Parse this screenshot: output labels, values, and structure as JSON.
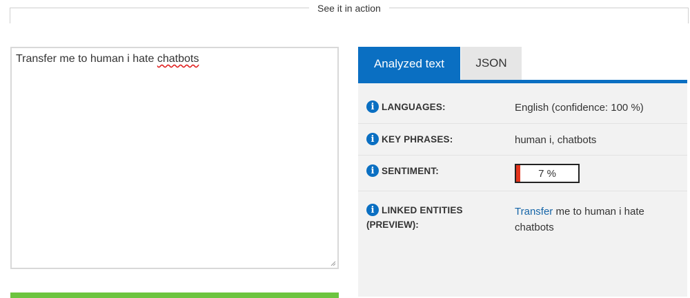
{
  "header": {
    "title": "See it in action"
  },
  "input": {
    "text_before": "Transfer me to human i hate ",
    "text_misspelled": "chatbots"
  },
  "tabs": [
    {
      "label": "Analyzed text",
      "active": true
    },
    {
      "label": "JSON",
      "active": false
    }
  ],
  "results": {
    "languages": {
      "label": "LANGUAGES:",
      "value": "English (confidence: 100 %)"
    },
    "key_phrases": {
      "label": "KEY PHRASES:",
      "value": "human i, chatbots"
    },
    "sentiment": {
      "label": "SENTIMENT:",
      "value_text": "7 %",
      "score_fraction": 0.07
    },
    "linked_entities": {
      "label_line1": "LINKED ENTITIES",
      "label_line2": "(PREVIEW):",
      "link_text": "Transfer",
      "rest_line1": " me to human i hate",
      "rest_line2": "chatbots"
    }
  },
  "colors": {
    "accent": "#0a6fc2",
    "sentiment_fill": "#e3341c",
    "submit_bar": "#6cc43f",
    "link": "#1565a8"
  }
}
